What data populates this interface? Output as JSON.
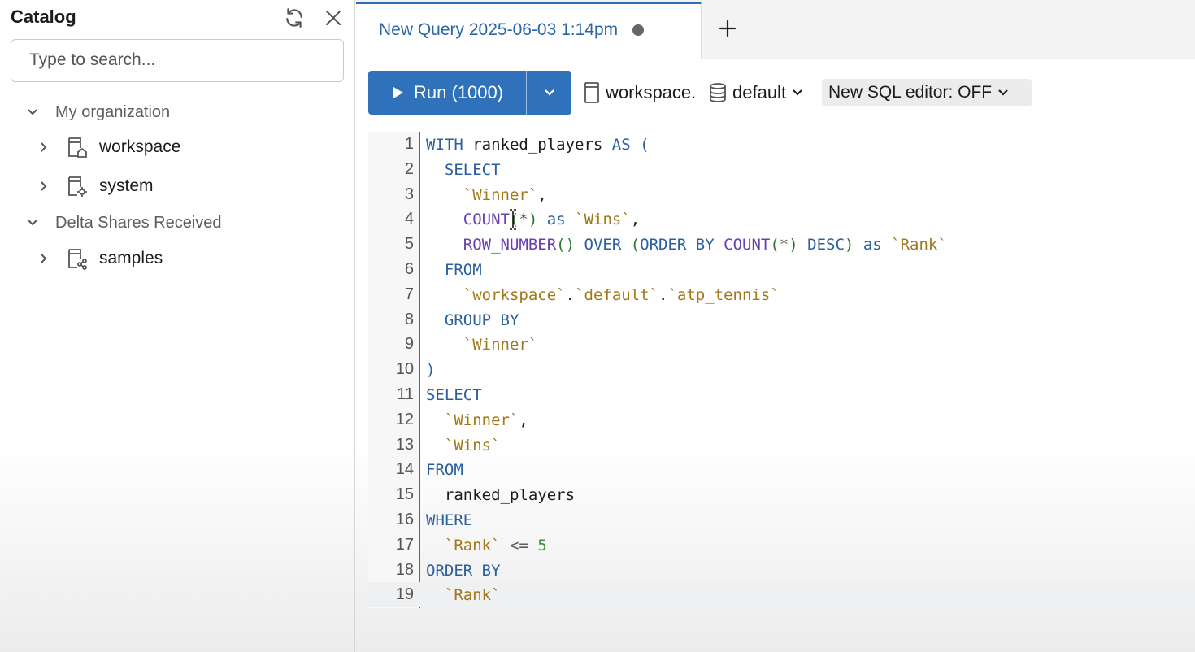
{
  "sidebar": {
    "title": "Catalog",
    "search_placeholder": "Type to search...",
    "groups": [
      {
        "label": "My organization",
        "items": [
          {
            "label": "workspace",
            "icon": "catalog-home-icon"
          },
          {
            "label": "system",
            "icon": "catalog-gear-icon"
          }
        ]
      },
      {
        "label": "Delta Shares Received",
        "items": [
          {
            "label": "samples",
            "icon": "catalog-share-icon"
          }
        ]
      }
    ]
  },
  "tabs": {
    "active_label": "New Query 2025-06-03 1:14pm",
    "add_icon": "plus-icon"
  },
  "toolbar": {
    "run_label": "Run (1000)",
    "catalog_label": "workspace",
    "catalog_sep": ".",
    "schema_label": "default",
    "editor_toggle_label": "New SQL editor: OFF"
  },
  "colors": {
    "accent": "#2f72bb",
    "tab_text": "#2866a8",
    "keyword": "#2b5f9e",
    "function": "#6a3fb3",
    "identifier": "#a0781a",
    "number": "#3d8a3d"
  },
  "editor": {
    "current_line": 19,
    "lines": [
      {
        "n": "1",
        "tokens": [
          [
            "kw",
            "WITH"
          ],
          [
            "",
            " ranked_players "
          ],
          [
            "kw",
            "AS"
          ],
          [
            "",
            " "
          ],
          [
            "kw",
            "("
          ]
        ]
      },
      {
        "n": "2",
        "tokens": [
          [
            "",
            "  "
          ],
          [
            "kw",
            "SELECT"
          ]
        ]
      },
      {
        "n": "3",
        "tokens": [
          [
            "",
            "    "
          ],
          [
            "id",
            "`Winner`"
          ],
          [
            "",
            ","
          ]
        ]
      },
      {
        "n": "4",
        "tokens": [
          [
            "",
            "    "
          ],
          [
            "fn",
            "COUNT"
          ],
          [
            "pn",
            "("
          ],
          [
            "op",
            "*"
          ],
          [
            "pn",
            ")"
          ],
          [
            "",
            " "
          ],
          [
            "kw",
            "as"
          ],
          [
            "",
            " "
          ],
          [
            "id",
            "`Wins`"
          ],
          [
            "",
            ","
          ]
        ]
      },
      {
        "n": "5",
        "tokens": [
          [
            "",
            "    "
          ],
          [
            "fn",
            "ROW_NUMBER"
          ],
          [
            "pn",
            "()"
          ],
          [
            "",
            " "
          ],
          [
            "kw",
            "OVER"
          ],
          [
            "",
            " "
          ],
          [
            "pn",
            "("
          ],
          [
            "kw",
            "ORDER BY"
          ],
          [
            "",
            " "
          ],
          [
            "fn",
            "COUNT"
          ],
          [
            "pn",
            "("
          ],
          [
            "op",
            "*"
          ],
          [
            "pn",
            ")"
          ],
          [
            "",
            " "
          ],
          [
            "kw",
            "DESC"
          ],
          [
            "pn",
            ")"
          ],
          [
            "",
            " "
          ],
          [
            "kw",
            "as"
          ],
          [
            "",
            " "
          ],
          [
            "id",
            "`Rank`"
          ]
        ]
      },
      {
        "n": "6",
        "tokens": [
          [
            "",
            "  "
          ],
          [
            "kw",
            "FROM"
          ]
        ]
      },
      {
        "n": "7",
        "tokens": [
          [
            "",
            "    "
          ],
          [
            "id",
            "`workspace`"
          ],
          [
            "",
            "."
          ],
          [
            "id",
            "`default`"
          ],
          [
            "",
            "."
          ],
          [
            "id",
            "`atp_tennis`"
          ]
        ]
      },
      {
        "n": "8",
        "tokens": [
          [
            "",
            "  "
          ],
          [
            "kw",
            "GROUP BY"
          ]
        ]
      },
      {
        "n": "9",
        "tokens": [
          [
            "",
            "    "
          ],
          [
            "id",
            "`Winner`"
          ]
        ]
      },
      {
        "n": "10",
        "tokens": [
          [
            "kw",
            ")"
          ]
        ]
      },
      {
        "n": "11",
        "tokens": [
          [
            "kw",
            "SELECT"
          ]
        ]
      },
      {
        "n": "12",
        "tokens": [
          [
            "",
            "  "
          ],
          [
            "id",
            "`Winner`"
          ],
          [
            "",
            ","
          ]
        ]
      },
      {
        "n": "13",
        "tokens": [
          [
            "",
            "  "
          ],
          [
            "id",
            "`Wins`"
          ]
        ]
      },
      {
        "n": "14",
        "tokens": [
          [
            "kw",
            "FROM"
          ]
        ]
      },
      {
        "n": "15",
        "tokens": [
          [
            "",
            "  ranked_players"
          ]
        ]
      },
      {
        "n": "16",
        "tokens": [
          [
            "kw",
            "WHERE"
          ]
        ]
      },
      {
        "n": "17",
        "tokens": [
          [
            "",
            "  "
          ],
          [
            "id",
            "`Rank`"
          ],
          [
            "",
            " "
          ],
          [
            "op",
            "<="
          ],
          [
            "",
            " "
          ],
          [
            "num",
            "5"
          ]
        ]
      },
      {
        "n": "18",
        "tokens": [
          [
            "kw",
            "ORDER BY"
          ]
        ]
      },
      {
        "n": "19",
        "tokens": [
          [
            "",
            "  "
          ],
          [
            "id",
            "`Rank`"
          ]
        ]
      }
    ]
  }
}
